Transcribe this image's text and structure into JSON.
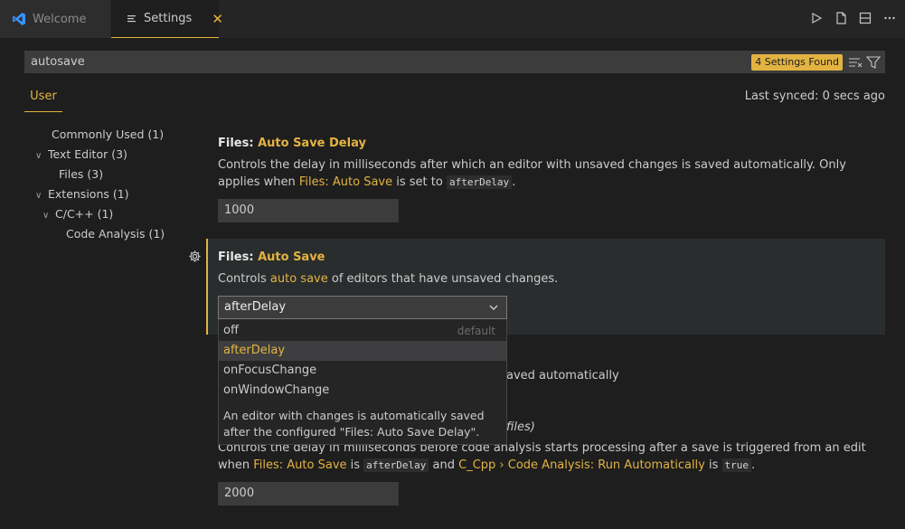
{
  "tabs": {
    "welcome": "Welcome",
    "settings": "Settings",
    "close_glyph": "✕"
  },
  "search": {
    "value": "autosave",
    "found": "4 Settings Found"
  },
  "scope": {
    "user": "User",
    "sync": "Last synced: 0 secs ago"
  },
  "tree": [
    {
      "label": "Commonly Used (1)",
      "chevron": ""
    },
    {
      "label": "Text Editor (3)",
      "chevron": "∨"
    },
    {
      "label": "Files (3)",
      "chevron": ""
    },
    {
      "label": "Extensions (1)",
      "chevron": "∨"
    },
    {
      "label": "C/C++ (1)",
      "chevron": "∨"
    },
    {
      "label": "Code Analysis (1)",
      "chevron": ""
    }
  ],
  "settings": {
    "delay": {
      "prefix": "Files: ",
      "name": "Auto Save Delay",
      "desc_1": "Controls the delay in milliseconds after which an editor with unsaved changes is saved automatically. Only applies when ",
      "desc_link": "Files: Auto Save",
      "desc_2": " is set to ",
      "desc_code": "afterDelay",
      "desc_3": ".",
      "value": "1000"
    },
    "autosave": {
      "prefix": "Files: ",
      "name": "Auto Save",
      "desc_1": "Controls ",
      "desc_link": "auto save",
      "desc_2": " of editors that have unsaved changes.",
      "value": "afterDelay"
    },
    "hidden_desc": "aved automatically",
    "cpp": {
      "title_tail": "files)",
      "desc_1": "Controls the delay in milliseconds before code analysis starts processing after a save is triggered from an edit when ",
      "desc_link1": "Files: Auto Save",
      "desc_2": " is ",
      "desc_code1": "afterDelay",
      "desc_3": " and ",
      "desc_link2": "C_Cpp › Code Analysis: Run Automatically",
      "desc_4": " is ",
      "desc_code2": "true",
      "desc_5": ".",
      "value": "2000"
    }
  },
  "dropdown": {
    "options": [
      "off",
      "afterDelay",
      "onFocusChange",
      "onWindowChange"
    ],
    "default_label": "default",
    "selected": "afterDelay",
    "description": "An editor with changes is automatically saved after the configured \"Files: Auto Save Delay\"."
  },
  "colors": {
    "accent": "#e3b341",
    "background": "#1e1e1e"
  }
}
